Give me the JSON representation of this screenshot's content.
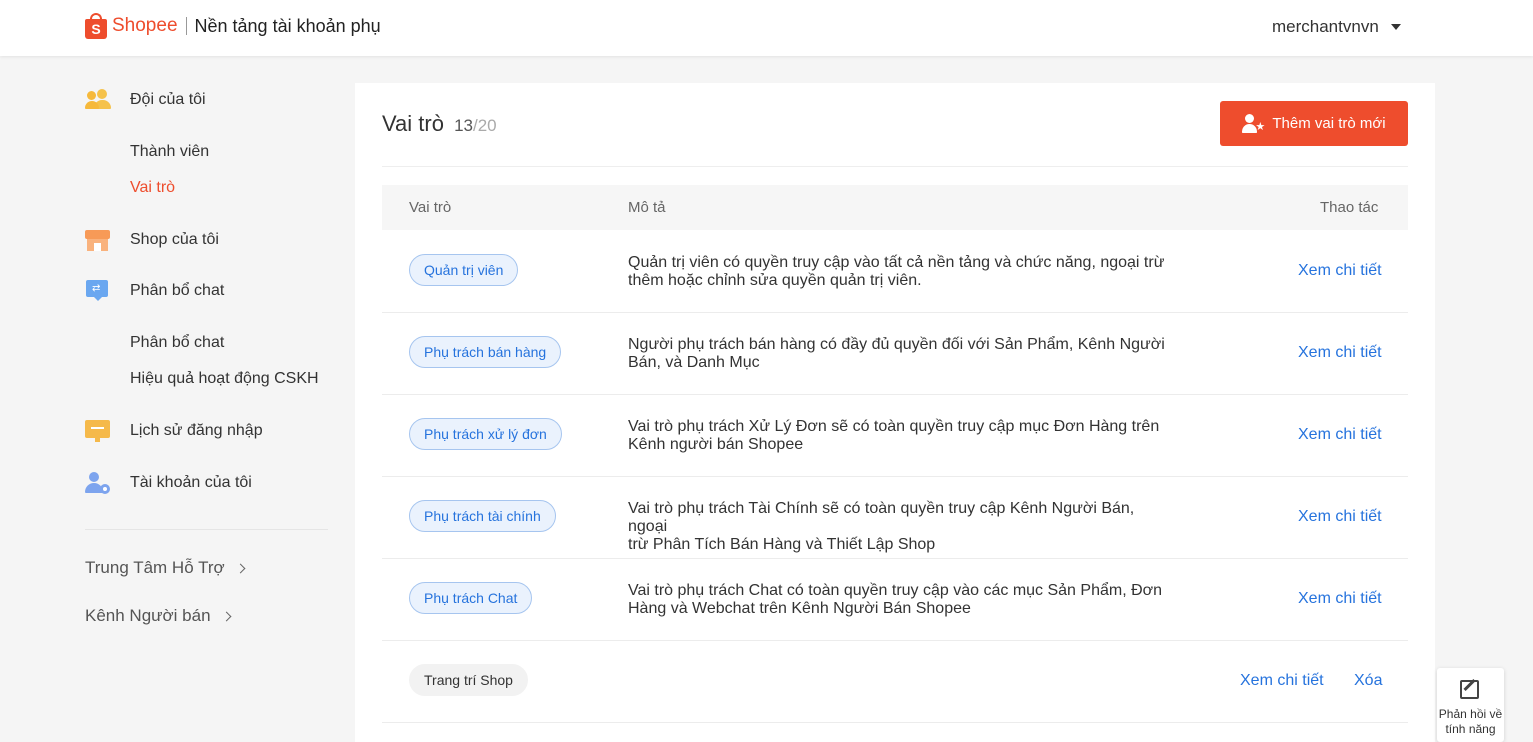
{
  "header": {
    "logo_letter": "S",
    "logo_text": "Shopee",
    "portal_title": "Nền tảng tài khoản phụ",
    "username": "merchantvnvn"
  },
  "sidebar": {
    "team": {
      "label": "Đội của tôi",
      "icon": "team-icon"
    },
    "members": "Thành viên",
    "roles": "Vai trò",
    "shop": {
      "label": "Shop của tôi",
      "icon": "shop-icon"
    },
    "chat": {
      "label": "Phân bổ chat",
      "icon": "chat-transfer-icon"
    },
    "chat_assign": "Phân bổ chat",
    "cs_performance": "Hiệu quả hoạt động CSKH",
    "login_history": {
      "label": "Lịch sử đăng nhập",
      "icon": "monitor-icon"
    },
    "my_account": {
      "label": "Tài khoản của tôi",
      "icon": "user-settings-icon"
    },
    "help_center": "Trung Tâm Hỗ Trợ",
    "seller_centre": "Kênh Người bán"
  },
  "main": {
    "title": "Vai trò",
    "count": "13",
    "total": "/20",
    "add_button": "Thêm vai trò mới",
    "columns": {
      "role": "Vai trò",
      "description": "Mô tả",
      "actions": "Thao tác"
    },
    "rows": [
      {
        "role": "Quản trị viên",
        "desc1": "Quản trị viên có quyền truy cập vào tất cả nền tảng và chức năng, ngoại trừ",
        "desc2": "thêm hoặc chỉnh sửa quyền quản trị viên.",
        "view": "Xem chi tiết"
      },
      {
        "role": "Phụ trách bán hàng",
        "desc1": "Người phụ trách bán hàng có đầy đủ quyền đối với Sản Phẩm, Kênh Người",
        "desc2": "Bán, và Danh Mục",
        "view": "Xem chi tiết"
      },
      {
        "role": "Phụ trách xử lý đơn",
        "desc1": "Vai trò phụ trách Xử Lý Đơn sẽ có toàn quyền truy cập mục Đơn Hàng trên",
        "desc2": "Kênh người bán Shopee",
        "view": "Xem chi tiết"
      },
      {
        "role": "Phụ trách tài chính",
        "desc1": "Vai trò phụ trách Tài Chính sẽ có toàn quyền truy cập Kênh Người Bán, ngoại",
        "desc2": "trừ Phân Tích Bán Hàng và Thiết Lập Shop",
        "view": "Xem chi tiết"
      },
      {
        "role": "Phụ trách Chat",
        "desc1": "Vai trò phụ trách Chat có toàn quyền truy cập vào các mục Sản Phẩm, Đơn",
        "desc2": "Hàng và Webchat trên Kênh Người Bán Shopee",
        "view": "Xem chi tiết"
      },
      {
        "role": "Trang trí Shop",
        "desc1": "",
        "desc2": "",
        "view": "Xem chi tiết",
        "delete": "Xóa"
      }
    ]
  },
  "feedback": {
    "line1": "Phản hồi về",
    "line2": "tính năng",
    "icon": "edit-icon"
  },
  "colors": {
    "brand": "#ee4d2d",
    "link": "#2673dd",
    "tag_bg": "#eaf2fd",
    "tag_border": "#a6c5ef"
  }
}
